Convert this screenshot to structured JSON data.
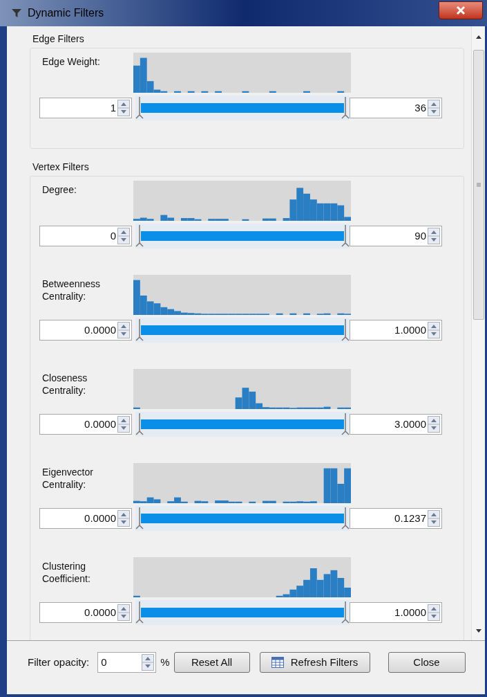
{
  "window": {
    "title": "Dynamic Filters"
  },
  "groups": [
    {
      "title": "Edge Filters",
      "filters": [
        {
          "label": "Edge Weight:",
          "min": "1",
          "max": "36",
          "thumbs": [
            {
              "level": 0
            },
            {
              "level": 1
            }
          ]
        }
      ]
    },
    {
      "title": "Vertex Filters",
      "filters": [
        {
          "label": "Degree:",
          "min": "0",
          "max": "90",
          "thumbs": [
            {
              "level": 0
            },
            {
              "level": 1
            }
          ]
        },
        {
          "label": "Betweenness Centrality:",
          "min": "0.0000",
          "max": "1.0000",
          "thumbs": [
            {
              "level": 0
            },
            {
              "level": 1
            }
          ]
        },
        {
          "label": "Closeness Centrality:",
          "min": "0.0000",
          "max": "3.0000",
          "thumbs": [
            {
              "level": 0
            },
            {
              "level": 1
            }
          ]
        },
        {
          "label": "Eigenvector Centrality:",
          "min": "0.0000",
          "max": "0.1237",
          "thumbs": [
            {
              "level": 0
            },
            {
              "level": 1
            }
          ]
        },
        {
          "label": "Clustering Coefficient:",
          "min": "0.0000",
          "max": "1.0000",
          "thumbs": [
            {
              "level": 0
            },
            {
              "level": 1
            }
          ]
        }
      ]
    }
  ],
  "footer": {
    "opacity_label": "Filter opacity:",
    "opacity_value": "0",
    "unit": "%",
    "buttons": [
      "Reset All",
      "Refresh Filters",
      "Close"
    ]
  }
}
